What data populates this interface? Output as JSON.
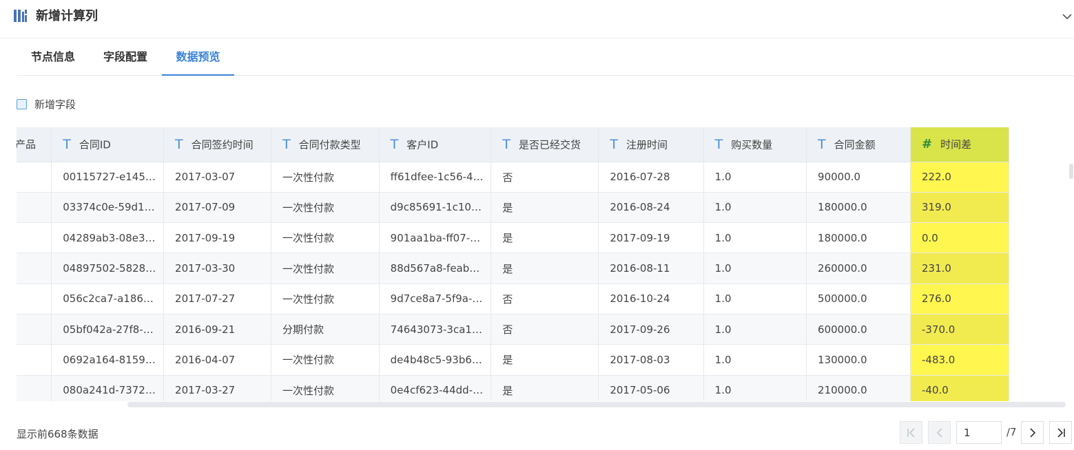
{
  "panel": {
    "title": "新增计算列"
  },
  "tabs": [
    {
      "label": "节点信息",
      "active": false
    },
    {
      "label": "字段配置",
      "active": false
    },
    {
      "label": "数据预览",
      "active": true
    }
  ],
  "add_field": {
    "label": "新增字段",
    "checked": false
  },
  "table": {
    "columns": [
      {
        "label": "产品",
        "type": "text",
        "partial_label": "产品"
      },
      {
        "label": "合同ID",
        "type": "text"
      },
      {
        "label": "合同签约时间",
        "type": "text"
      },
      {
        "label": "合同付款类型",
        "type": "text"
      },
      {
        "label": "客户ID",
        "type": "text"
      },
      {
        "label": "是否已经交货",
        "type": "text"
      },
      {
        "label": "注册时间",
        "type": "text"
      },
      {
        "label": "购买数量",
        "type": "text"
      },
      {
        "label": "合同金额",
        "type": "text"
      },
      {
        "label": "时间差",
        "type": "number",
        "highlighted": true
      }
    ],
    "rows": [
      [
        "",
        "00115727-e145…",
        "2017-03-07",
        "一次性付款",
        "ff61dfee-1c56-4…",
        "否",
        "2016-07-28",
        "1.0",
        "90000.0",
        "222.0"
      ],
      [
        "",
        "03374c0e-59d1…",
        "2017-07-09",
        "一次性付款",
        "d9c85691-1c10…",
        "是",
        "2016-08-24",
        "1.0",
        "180000.0",
        "319.0"
      ],
      [
        "",
        "04289ab3-08e3…",
        "2017-09-19",
        "一次性付款",
        "901aa1ba-ff07-…",
        "是",
        "2017-09-19",
        "1.0",
        "180000.0",
        "0.0"
      ],
      [
        "",
        "04897502-5828…",
        "2017-03-30",
        "一次性付款",
        "88d567a8-feab…",
        "是",
        "2016-08-11",
        "1.0",
        "260000.0",
        "231.0"
      ],
      [
        "",
        "056c2ca7-a186…",
        "2017-07-27",
        "一次性付款",
        "9d7ce8a7-5f9a-…",
        "否",
        "2016-10-24",
        "1.0",
        "500000.0",
        "276.0"
      ],
      [
        "",
        "05bf042a-27f8-…",
        "2016-09-21",
        "分期付款",
        "74643073-3ca1…",
        "否",
        "2017-09-26",
        "1.0",
        "600000.0",
        "-370.0"
      ],
      [
        "",
        "0692a164-8159…",
        "2016-04-07",
        "一次性付款",
        "de4b48c5-93b6…",
        "是",
        "2017-08-03",
        "1.0",
        "130000.0",
        "-483.0"
      ],
      [
        "",
        "080a241d-7372…",
        "2017-03-27",
        "一次性付款",
        "0e4cf623-44dd-…",
        "是",
        "2017-05-06",
        "1.0",
        "210000.0",
        "-40.0"
      ]
    ]
  },
  "footer": {
    "summary": "显示前668条数据"
  },
  "pagination": {
    "current_page": "1",
    "total": "/7"
  },
  "colors": {
    "accent": "#3a83d8",
    "highlight_header": "#d9e44a",
    "highlight_cell": "#fff64f"
  }
}
